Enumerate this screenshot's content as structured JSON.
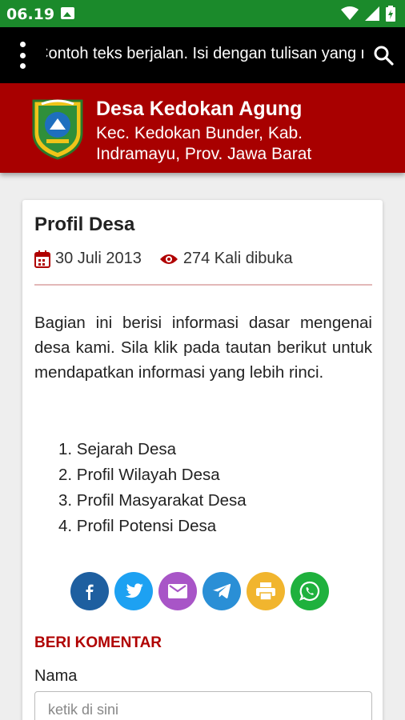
{
  "status_bar": {
    "time": "06.19"
  },
  "top_bar": {
    "marquee_text": "Contoh teks berjalan. Isi dengan tulisan yang menampilkan"
  },
  "header": {
    "title": "Desa Kedokan Agung",
    "subtitle": "Kec. Kedokan Bunder, Kab. Indramayu, Prov. Jawa Barat"
  },
  "article": {
    "title": "Profil Desa",
    "date": "30 Juli 2013",
    "views": "274 Kali dibuka",
    "paragraph": "Bagian ini berisi informasi dasar mengenai desa kami. Sila klik pada tautan berikut untuk mendapatkan informasi yang lebih rinci.",
    "links": [
      "1. Sejarah Desa",
      "2. Profil Wilayah Desa",
      "3. Profil Masyarakat Desa",
      "4. Profil Potensi Desa"
    ]
  },
  "share": {
    "buttons": [
      {
        "icon": "facebook-icon",
        "color": "#1e5fa0"
      },
      {
        "icon": "twitter-icon",
        "color": "#1da1f2"
      },
      {
        "icon": "email-icon",
        "color": "#a855c7"
      },
      {
        "icon": "telegram-icon",
        "color": "#2a8fd6"
      },
      {
        "icon": "print-icon",
        "color": "#f1b52e"
      },
      {
        "icon": "whatsapp-icon",
        "color": "#1fb13d"
      }
    ]
  },
  "comment": {
    "heading": "BERI KOMENTAR",
    "name_label": "Nama",
    "name_placeholder": "ketik di sini"
  },
  "colors": {
    "status": "#1b8a2b",
    "header": "#a80000",
    "accent": "#b00000"
  }
}
